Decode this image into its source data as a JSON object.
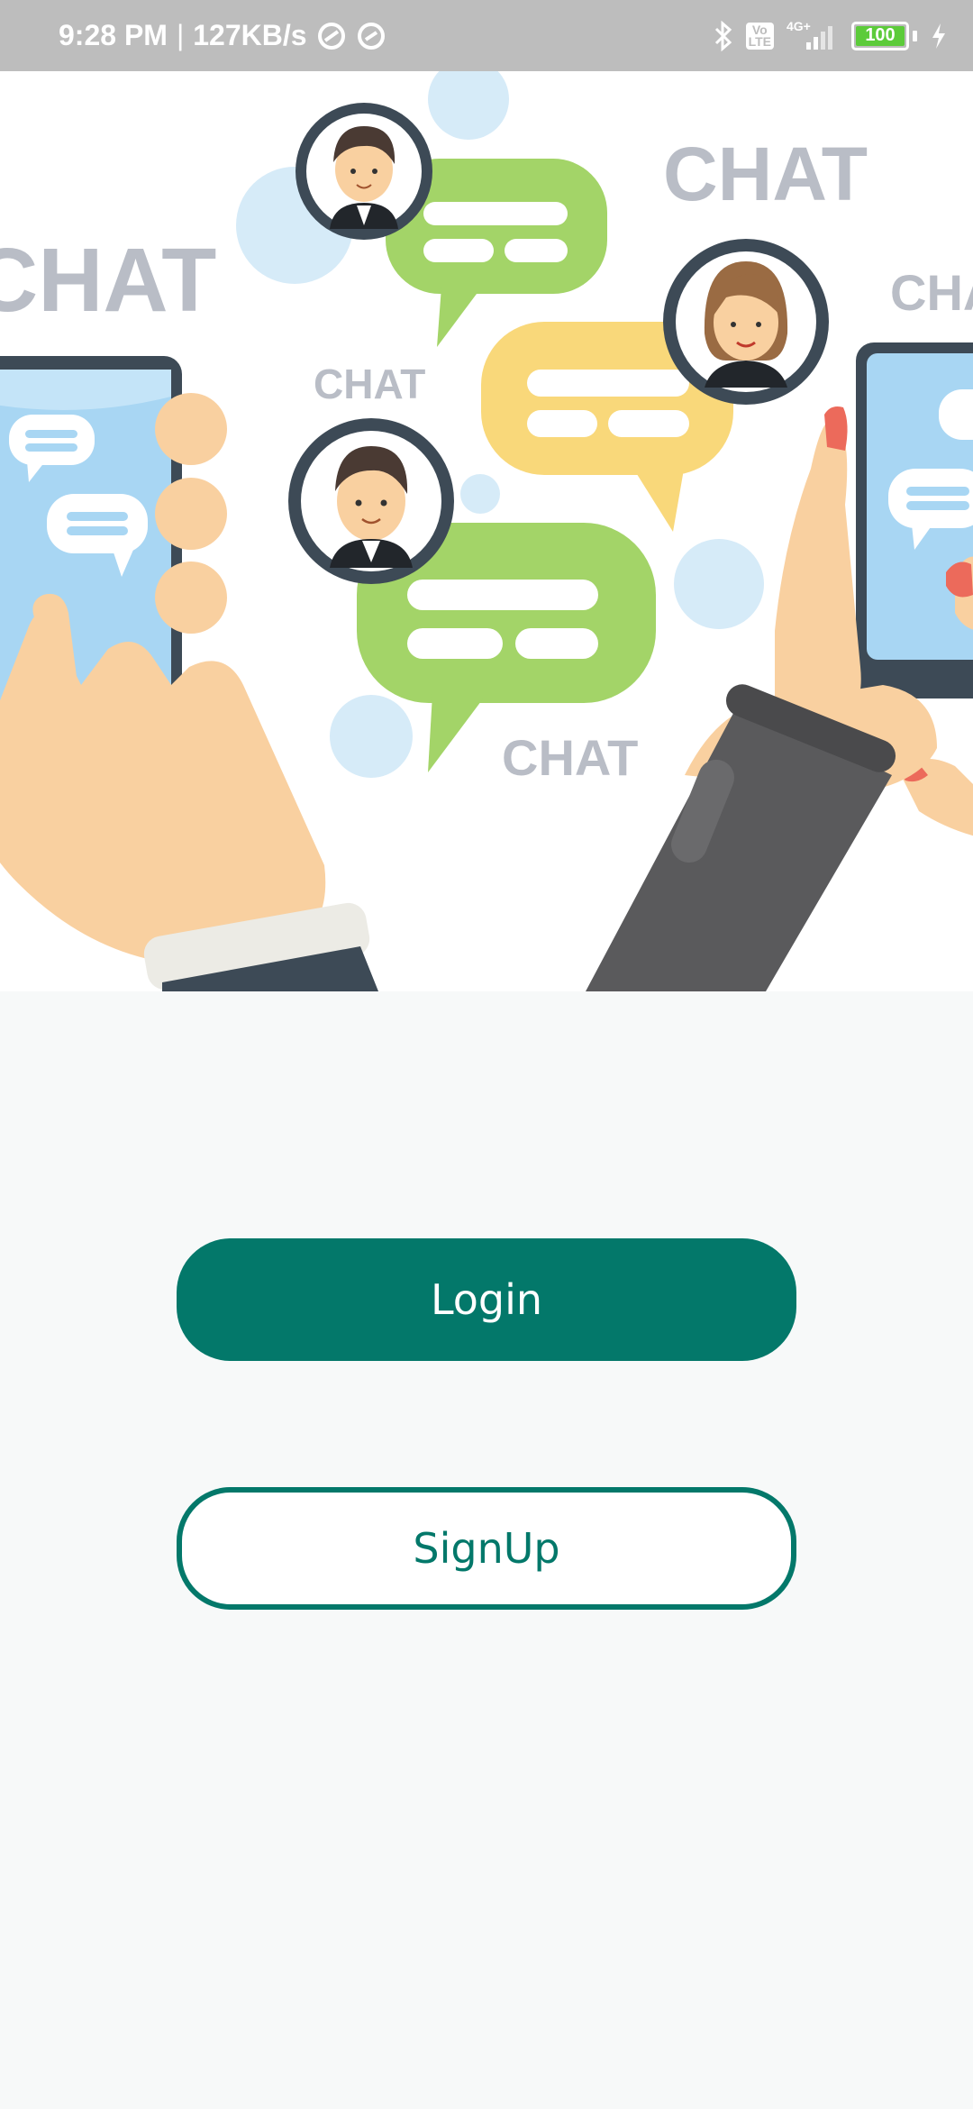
{
  "status_bar": {
    "time": "9:28 PM",
    "separator": "|",
    "speed": "127KB/s",
    "volte_top": "Vo",
    "volte_bottom": "LTE",
    "network": "4G+",
    "battery": "100"
  },
  "hero": {
    "word_1": "CHAT",
    "word_2": "CHAT",
    "word_3": "CHAT",
    "word_4": "CHAT",
    "word_5": "CHAT",
    "colors": {
      "green_bubble": "#a3d468",
      "yellow_bubble": "#f9d87a",
      "skin": "#f9d0a0",
      "phone_screen": "#a8d6f3",
      "sleeve_dark": "#5a5a5c",
      "chat_text": "#b9bdc6"
    }
  },
  "actions": {
    "login_label": "Login",
    "signup_label": "SignUp"
  },
  "theme": {
    "primary": "#03786a",
    "background": "#f7f9f9",
    "status_bar": "#bdbdbd"
  }
}
